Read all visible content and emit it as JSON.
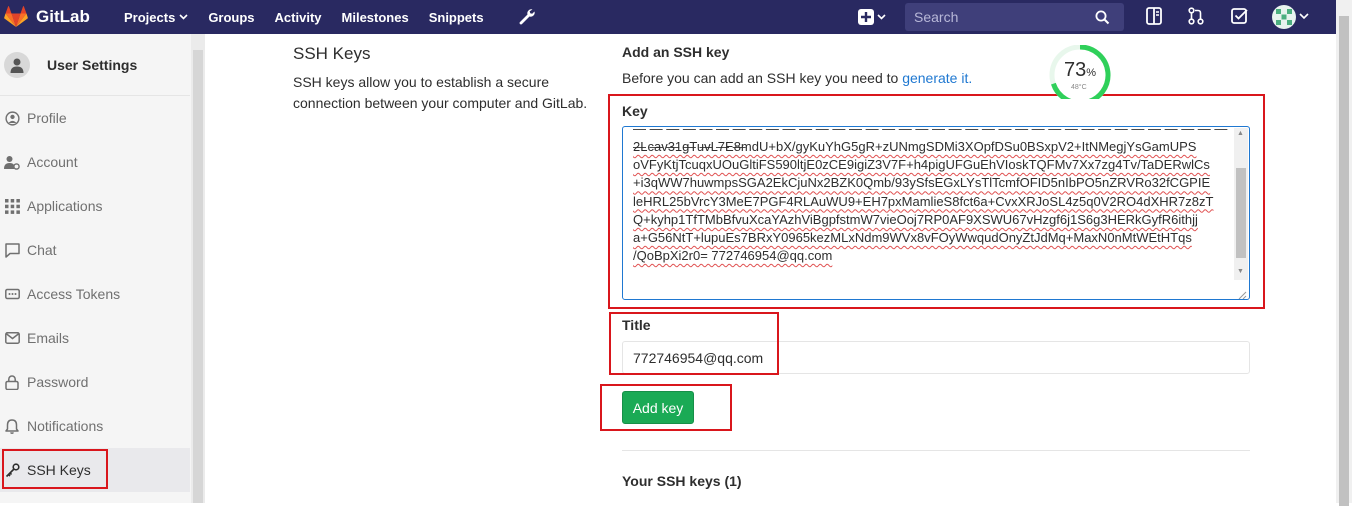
{
  "brand": {
    "name": "GitLab"
  },
  "nav": {
    "projects": "Projects",
    "groups": "Groups",
    "activity": "Activity",
    "milestones": "Milestones",
    "snippets": "Snippets"
  },
  "search": {
    "placeholder": "Search"
  },
  "sidebar": {
    "title": "User Settings",
    "items": [
      {
        "label": "Profile",
        "icon": "profile-icon"
      },
      {
        "label": "Account",
        "icon": "account-icon"
      },
      {
        "label": "Applications",
        "icon": "applications-icon"
      },
      {
        "label": "Chat",
        "icon": "chat-icon"
      },
      {
        "label": "Access Tokens",
        "icon": "access-tokens-icon"
      },
      {
        "label": "Emails",
        "icon": "emails-icon"
      },
      {
        "label": "Password",
        "icon": "password-icon"
      },
      {
        "label": "Notifications",
        "icon": "notifications-icon"
      },
      {
        "label": "SSH Keys",
        "icon": "ssh-keys-icon"
      }
    ],
    "active": "SSH Keys"
  },
  "section": {
    "title": "SSH Keys",
    "description": "SSH keys allow you to establish a secure connection between your computer and GitLab."
  },
  "form": {
    "heading": "Add an SSH key",
    "intro_prefix": "Before you can add an SSH key you need to ",
    "intro_link": "generate it.",
    "key_label": "Key",
    "key_lines": [
      "2Lcav31gTuvL7E8mdU+bX/gyKuYhG5gR+zUNmgSDMi3XOpfDSu0BSxpV2+ItNMegjYsGamUPS",
      "oVFyKtjTcuqxUOuGltiFS590ltjE0zCE9igiZ3V7F+h4pigUFGuEhVIoskTQFMv7Xx7zg4Tv/TaDERwlCs",
      "+i3qWW7huwmpsSGA2EkCjuNx2BZK0Qmb/93ySfsEGxLYsTlTcmfOFID5nIbPO5nZRVRo32fCGPIE",
      "leHRL25bVrcY3MeE7PGF4RLAuWU9+EH7pxMamlieS8fct6a+CvxXRJoSL4z5q0V2RO4dXHR7z8zT",
      "Q+kyhp1TfTMbBfvuXcaYAzhViBgpfstmW7vieOoj7RP0AF9XSWU67vHzgf6j1S6g3HERkGyfR6ithjj",
      "a+G56NtT+lupuEs7BRxY0965kezMLxNdm9WVx8vFOyWwqudOnyZtJdMq+MaxN0nMtWEtHTqs",
      "/QoBpXi2r0= 772746954@qq.com"
    ],
    "title_label": "Title",
    "title_value": "772746954@qq.com",
    "submit_label": "Add key",
    "your_keys": "Your SSH keys (1)"
  },
  "widget": {
    "value": "73",
    "unit": "%",
    "sub": "48°C"
  },
  "colors": {
    "navbar": "#292961",
    "link": "#1f78d1",
    "success": "#1aaa55",
    "annotation": "#d9161c",
    "gauge": "#2fd05a"
  }
}
